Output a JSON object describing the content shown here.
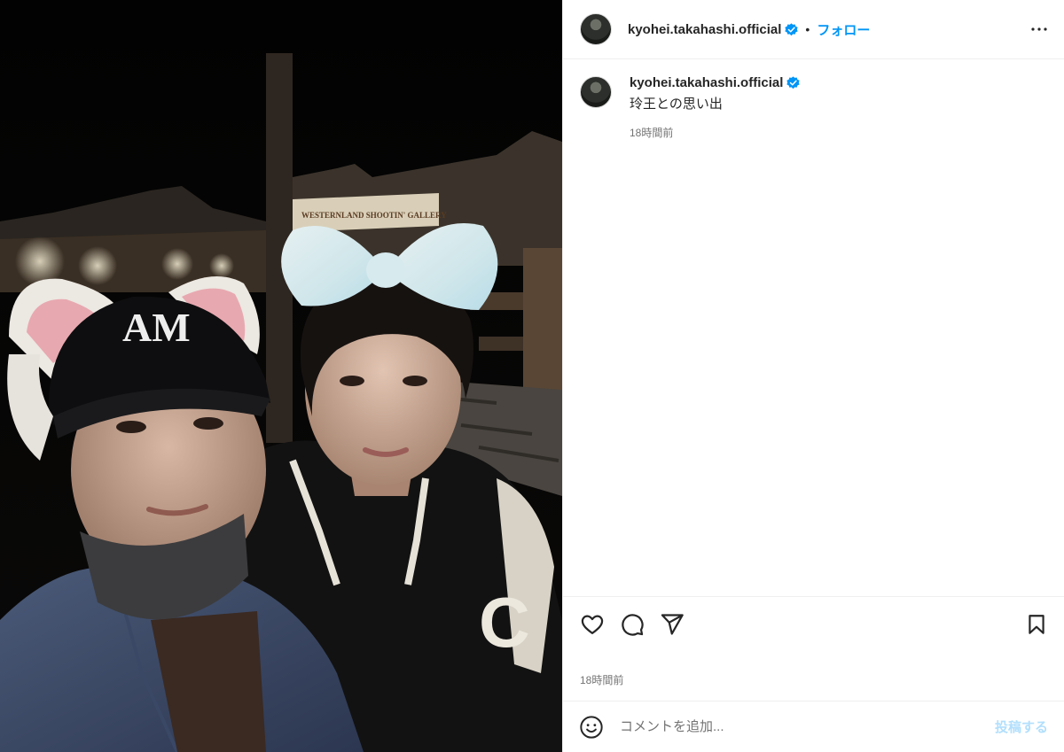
{
  "post": {
    "username": "kyohei.takahashi.official",
    "follow_label": "フォロー",
    "separator": "•",
    "caption": "玲王との思い出",
    "caption_time": "18時間前",
    "post_time": "18時間前",
    "photo_sign_text": "WESTERNLAND SHOOTIN' GALLERY",
    "cap_logo_text": "AM",
    "jacket_letter": "C"
  },
  "comment": {
    "placeholder": "コメントを追加...",
    "post_label": "投稿する"
  },
  "icons": {
    "verified": "verified-badge-icon",
    "more": "more-options-icon",
    "like": "heart-icon",
    "comment": "comment-bubble-icon",
    "share": "paper-plane-icon",
    "save": "bookmark-icon",
    "emoji": "emoji-smile-icon"
  },
  "colors": {
    "accent": "#0095f6",
    "verified": "#0095f6",
    "post_disabled": "#b2dffc"
  }
}
